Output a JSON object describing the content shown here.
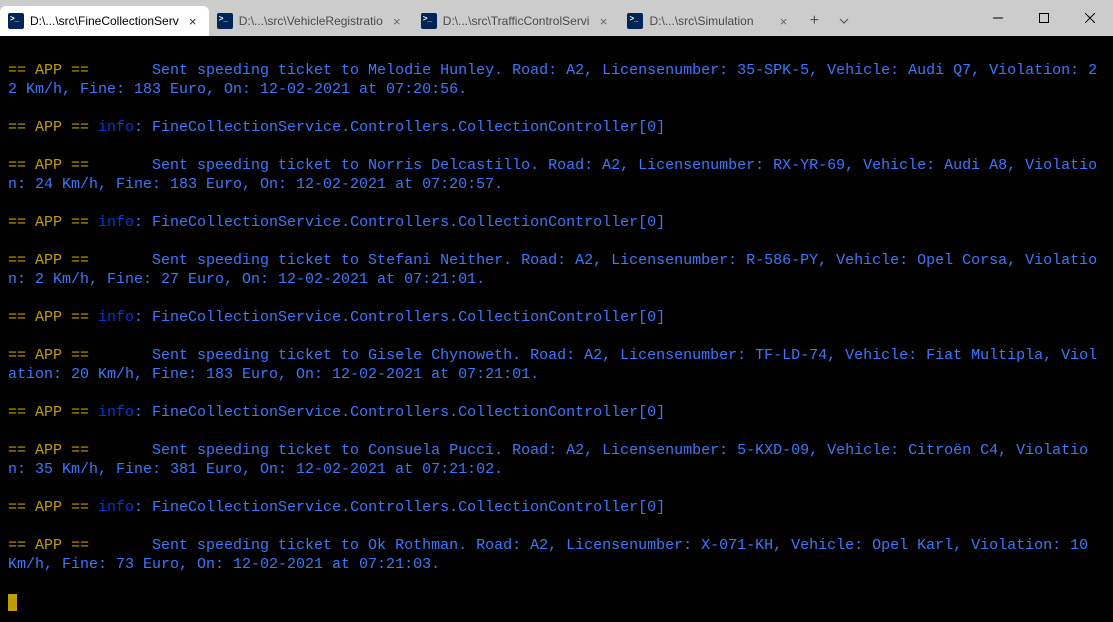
{
  "tabs": [
    {
      "title": "D:\\...\\src\\FineCollectionServ",
      "active": true
    },
    {
      "title": "D:\\...\\src\\VehicleRegistratio",
      "active": false
    },
    {
      "title": "D:\\...\\src\\TrafficControlServi",
      "active": false
    },
    {
      "title": "D:\\...\\src\\Simulation",
      "active": false
    }
  ],
  "newtab_label": "+",
  "close_label": "×",
  "log": {
    "prefix_app": "== APP ==",
    "prefix_info": "info",
    "controller": "FineCollectionService.Controllers.CollectionController[0]",
    "entries": [
      {
        "type": "msg",
        "text": "      Sent speeding ticket to Melodie Hunley. Road: A2, Licensenumber: 35-SPK-5, Vehicle: Audi Q7, Violation: 22 Km/h, Fine: 183 Euro, On: 12-02-2021 at 07:20:56."
      },
      {
        "type": "info"
      },
      {
        "type": "msg",
        "text": "      Sent speeding ticket to Norris Delcastillo. Road: A2, Licensenumber: RX-YR-69, Vehicle: Audi A8, Violation: 24 Km/h, Fine: 183 Euro, On: 12-02-2021 at 07:20:57."
      },
      {
        "type": "info"
      },
      {
        "type": "msg",
        "text": "      Sent speeding ticket to Stefani Neither. Road: A2, Licensenumber: R-586-PY, Vehicle: Opel Corsa, Violation: 2 Km/h, Fine: 27 Euro, On: 12-02-2021 at 07:21:01."
      },
      {
        "type": "info"
      },
      {
        "type": "msg",
        "text": "      Sent speeding ticket to Gisele Chynoweth. Road: A2, Licensenumber: TF-LD-74, Vehicle: Fiat Multipla, Violation: 20 Km/h, Fine: 183 Euro, On: 12-02-2021 at 07:21:01."
      },
      {
        "type": "info"
      },
      {
        "type": "msg",
        "text": "      Sent speeding ticket to Consuela Pucci. Road: A2, Licensenumber: 5-KXD-09, Vehicle: Citroën C4, Violation: 35 Km/h, Fine: 381 Euro, On: 12-02-2021 at 07:21:02."
      },
      {
        "type": "info"
      },
      {
        "type": "msg",
        "text": "      Sent speeding ticket to Ok Rothman. Road: A2, Licensenumber: X-071-KH, Vehicle: Opel Karl, Violation: 10 Km/h, Fine: 73 Euro, On: 12-02-2021 at 07:21:03."
      }
    ]
  }
}
